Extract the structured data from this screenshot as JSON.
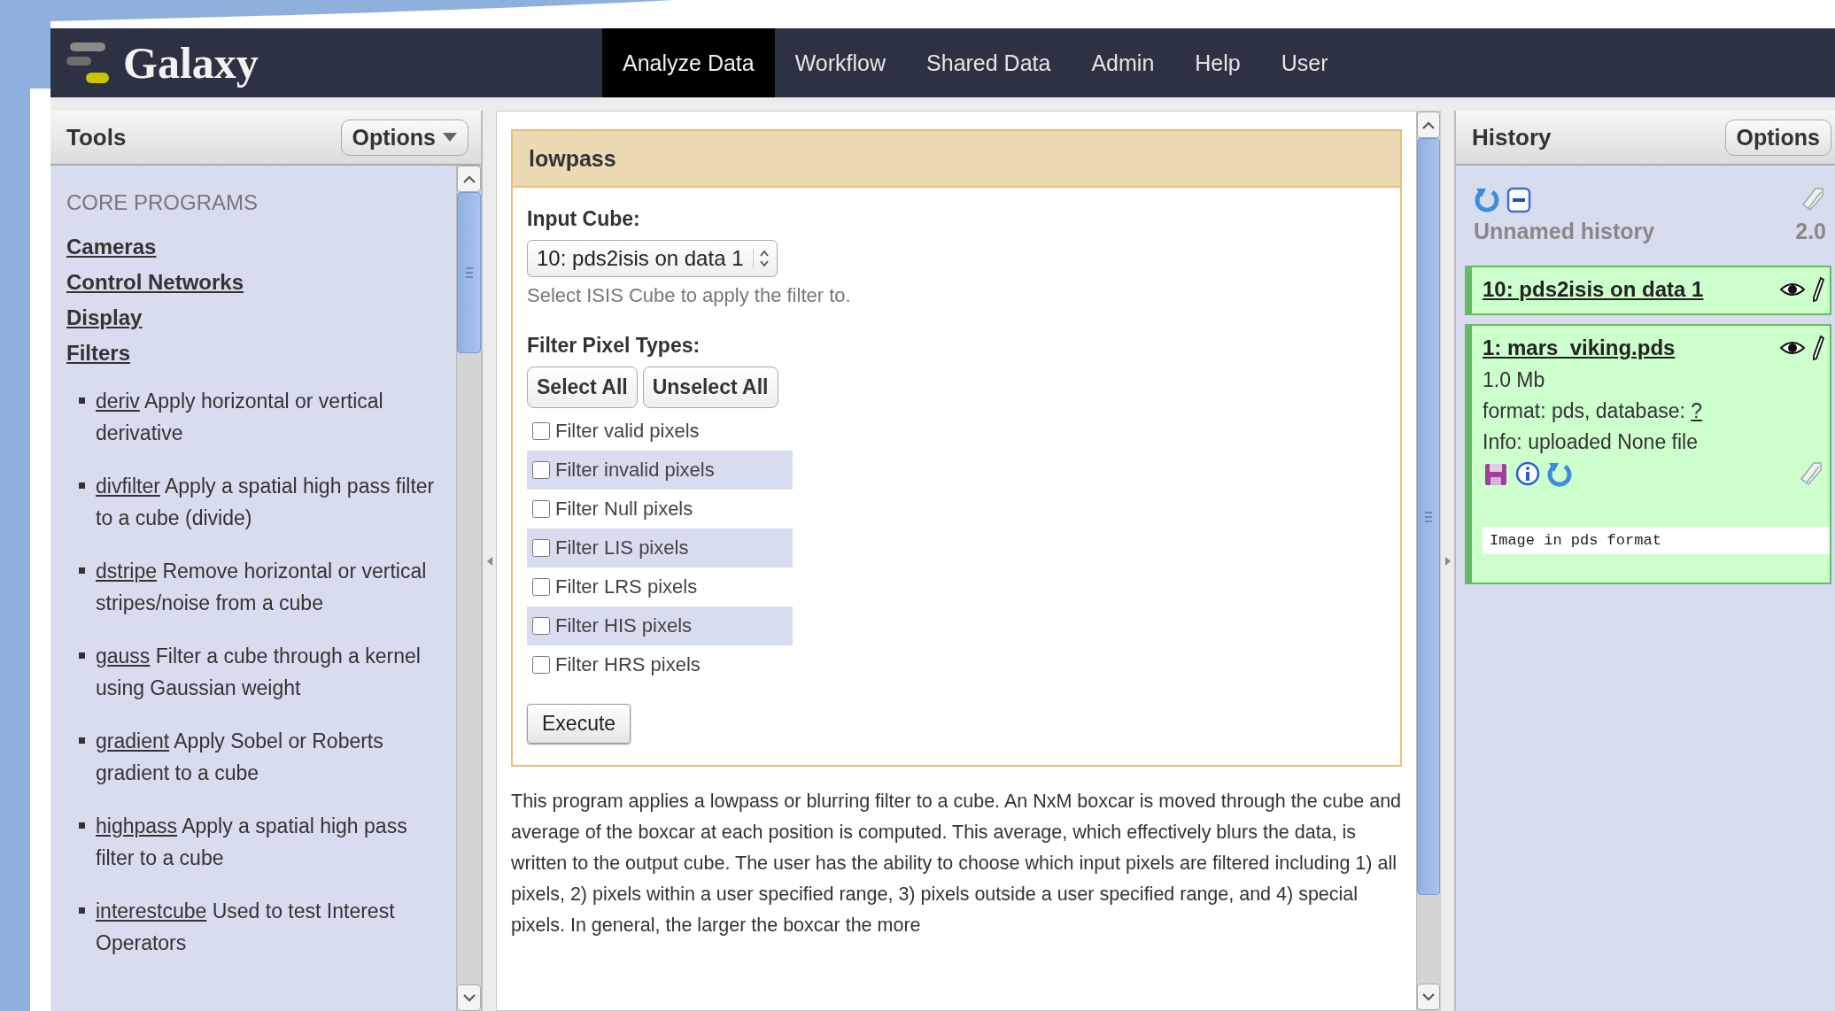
{
  "masthead": {
    "brand": "Galaxy",
    "nav": [
      {
        "label": "Analyze Data",
        "selected": true
      },
      {
        "label": "Workflow",
        "selected": false
      },
      {
        "label": "Shared Data",
        "selected": false
      },
      {
        "label": "Admin",
        "selected": false
      },
      {
        "label": "Help",
        "selected": false
      },
      {
        "label": "User",
        "selected": false
      }
    ]
  },
  "tools_panel": {
    "title": "Tools",
    "options_button": "Options",
    "section": "CORE PROGRAMS",
    "categories": [
      "Cameras",
      "Control Networks",
      "Display",
      "Filters"
    ],
    "tools": [
      {
        "name": "deriv",
        "description": "Apply horizontal or vertical derivative"
      },
      {
        "name": "divfilter",
        "description": "Apply a spatial high pass filter to a cube (divide)"
      },
      {
        "name": "dstripe",
        "description": "Remove horizontal or vertical stripes/noise from a cube"
      },
      {
        "name": "gauss",
        "description": "Filter a cube through a kernel using Gaussian weight"
      },
      {
        "name": "gradient",
        "description": "Apply Sobel or Roberts gradient to a cube"
      },
      {
        "name": "highpass",
        "description": "Apply a spatial high pass filter to a cube"
      },
      {
        "name": "interestcube",
        "description": "Used to test Interest Operators"
      }
    ]
  },
  "tool_form": {
    "title": "lowpass",
    "input_label": "Input Cube:",
    "input_value": "10: pds2isis on data 1",
    "input_help": "Select ISIS Cube to apply the filter to.",
    "filter_label": "Filter Pixel Types:",
    "buttons": [
      "Select All",
      "Unselect All"
    ],
    "checkboxes": [
      {
        "label": "Filter valid pixels",
        "checked": false
      },
      {
        "label": "Filter invalid pixels",
        "checked": false
      },
      {
        "label": "Filter Null pixels",
        "checked": false
      },
      {
        "label": "Filter LIS pixels",
        "checked": false
      },
      {
        "label": "Filter LRS pixels",
        "checked": false
      },
      {
        "label": "Filter HIS pixels",
        "checked": false
      },
      {
        "label": "Filter HRS pixels",
        "checked": false
      }
    ],
    "execute_button": "Execute",
    "description": "This program applies a lowpass or blurring filter to a cube. An NxM boxcar is moved through the cube and average of the boxcar at each position is computed. This average, which effectively blurs the data, is written to the output cube. The user has the ability to choose which input pixels are filtered including 1) all pixels, 2) pixels within a user specified range, 3) pixels outside a user specified range, and 4) special pixels. In general, the larger the boxcar the more"
  },
  "history_panel": {
    "title": "History",
    "options_button": "Options",
    "history_name": "Unnamed history",
    "history_size": "2.0",
    "datasets": [
      {
        "title": "10: pds2isis on data 1",
        "expanded": false
      },
      {
        "title": "1: mars_viking.pds",
        "expanded": true,
        "size": "1.0 Mb",
        "format": "format: pds, database:",
        "database": "?",
        "info": "Info: uploaded None file",
        "peek": "Image in pds format"
      }
    ]
  }
}
